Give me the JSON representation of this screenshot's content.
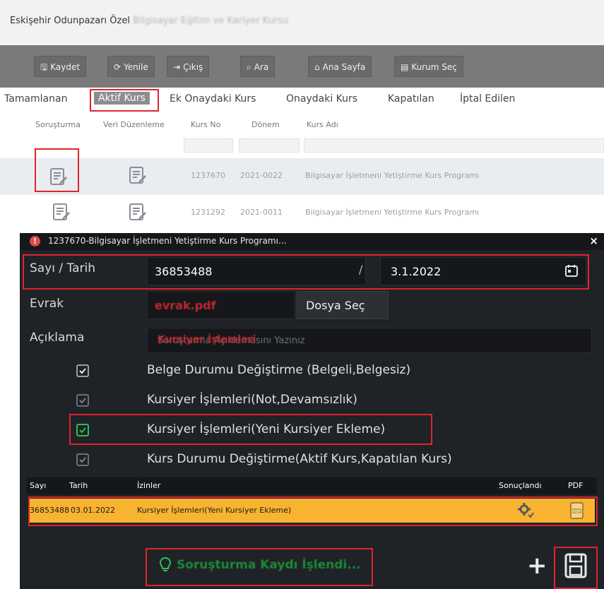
{
  "header": {
    "title_visible": "Eskişehir Odunpazarı Özel",
    "title_blurred": "Bilgisayar Eğitim ve Kariyer Kursu"
  },
  "toolbar": {
    "buttons": [
      {
        "label": "Kaydet",
        "icon": "save-icon"
      },
      {
        "label": "Yenile",
        "icon": "refresh-icon"
      },
      {
        "label": "Çıkış",
        "icon": "exit-icon"
      },
      {
        "label": "Ara",
        "icon": "search-icon"
      },
      {
        "label": "Ana Sayfa",
        "icon": "home-icon"
      },
      {
        "label": "Kurum Seç",
        "icon": "institution-icon"
      }
    ]
  },
  "tabs": [
    {
      "label": "Tamamlanan",
      "active": false
    },
    {
      "label": "Aktif Kurs",
      "active": true
    },
    {
      "label": "Ek Onaydaki Kurs",
      "active": false
    },
    {
      "label": "Onaydaki Kurs",
      "active": false
    },
    {
      "label": "Kapatılan",
      "active": false
    },
    {
      "label": "İptal Edilen",
      "active": false
    }
  ],
  "grid": {
    "columns": [
      "Soruşturma",
      "Veri Düzenleme",
      "Kurs No",
      "Dönem",
      "Kurs Adı"
    ],
    "rows": [
      {
        "kurs_no": "1237670",
        "donem": "2021-0022",
        "kurs_adi": "Bilgisayar İşletmeni Yetiştirme Kurs Programı"
      },
      {
        "kurs_no": "1231292",
        "donem": "2021-0011",
        "kurs_adi": "Bilgisayar İşletmeni Yetiştirme Kurs Programı"
      }
    ]
  },
  "dialog": {
    "title": "1237670-Bilgisayar İşletmeni Yetiştirme Kurs Programı...",
    "close": "×",
    "sayi_tarih_label": "Sayı / Tarih",
    "sayi_value": "36853488",
    "separator": "/",
    "tarih_value": "3.1.2022",
    "evrak_label": "Evrak",
    "evrak_file": "evrak.pdf",
    "dosya_sec_label": "Dosya Seç",
    "aciklama_label": "Açıklama",
    "aciklama_value": "Kursiyer İşlemleri",
    "aciklama_placeholder": "Soruşturma Açıklamasını Yazınız",
    "checkboxes": [
      {
        "label": "Belge Durumu Değiştirme (Belgeli,Belgesiz)",
        "checked": true
      },
      {
        "label": "Kursiyer İşlemleri(Not,Devamsızlık)",
        "checked": true
      },
      {
        "label": "Kursiyer İşlemleri(Yeni Kursiyer Ekleme)",
        "checked": true
      },
      {
        "label": "Kurs Durumu Değiştirme(Aktif Kurs,Kapatılan Kurs)",
        "checked": true
      }
    ],
    "results": {
      "columns": [
        "Sayı",
        "Tarih",
        "İzinler",
        "Sonuçlandı",
        "PDF"
      ],
      "row": {
        "sayi": "36853488",
        "tarih": "03.01.2022",
        "izinler": "Kursiyer İşlemleri(Yeni Kursiyer Ekleme)"
      }
    },
    "status_message": "Soruşturma Kaydı İşlendi..."
  },
  "colors": {
    "highlight_red": "#e0242f",
    "dialog_bg": "#1f2226",
    "row_highlight": "#f8b331",
    "success_green": "#1c8a3a"
  }
}
